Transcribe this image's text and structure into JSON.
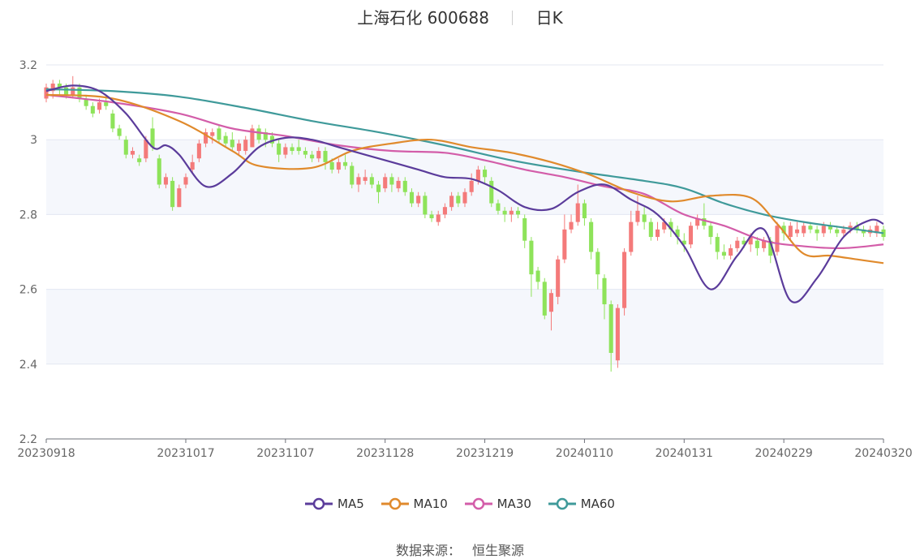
{
  "header": {
    "name": "上海石化",
    "code": "600688",
    "period": "日K"
  },
  "source": {
    "label": "数据来源：",
    "value": "恒生聚源"
  },
  "colors": {
    "up": "#f47a7a",
    "down": "#8ee35a",
    "grid": "#e3e7f2",
    "band": "#f5f7fc",
    "MA5": "#5b3c9b",
    "MA10": "#e08a2c",
    "MA30": "#d35da9",
    "MA60": "#3f9a9a"
  },
  "chart_data": {
    "type": "candlestick",
    "x_ticks": [
      "20230918",
      "20231017",
      "20231107",
      "20231128",
      "20231219",
      "20240110",
      "20240131",
      "20240229",
      "20240320"
    ],
    "x_tick_index": [
      0,
      21,
      36,
      51,
      66,
      81,
      96,
      111,
      126
    ],
    "ylim": [
      2.2,
      3.2
    ],
    "y_ticks": [
      "2.2",
      "2.4",
      "2.6",
      "2.8",
      "3",
      "3.2"
    ],
    "legend": [
      "MA5",
      "MA10",
      "MA30",
      "MA60"
    ],
    "candles": [
      [
        3.11,
        3.14,
        3.15,
        3.1
      ],
      [
        3.13,
        3.15,
        3.16,
        3.11
      ],
      [
        3.15,
        3.14,
        3.16,
        3.12
      ],
      [
        3.14,
        3.12,
        3.15,
        3.11
      ],
      [
        3.12,
        3.14,
        3.17,
        3.11
      ],
      [
        3.14,
        3.11,
        3.15,
        3.1
      ],
      [
        3.11,
        3.09,
        3.12,
        3.08
      ],
      [
        3.09,
        3.07,
        3.1,
        3.06
      ],
      [
        3.08,
        3.1,
        3.11,
        3.07
      ],
      [
        3.1,
        3.09,
        3.12,
        3.08
      ],
      [
        3.07,
        3.03,
        3.08,
        3.02
      ],
      [
        3.03,
        3.01,
        3.04,
        3.0
      ],
      [
        3.0,
        2.96,
        3.01,
        2.95
      ],
      [
        2.96,
        2.97,
        2.98,
        2.95
      ],
      [
        2.95,
        2.94,
        2.96,
        2.93
      ],
      [
        2.95,
        3.0,
        3.01,
        2.94
      ],
      [
        3.03,
        2.98,
        3.06,
        2.97
      ],
      [
        2.95,
        2.88,
        2.96,
        2.87
      ],
      [
        2.88,
        2.9,
        2.91,
        2.87
      ],
      [
        2.89,
        2.82,
        2.9,
        2.81
      ],
      [
        2.82,
        2.87,
        2.88,
        2.82
      ],
      [
        2.88,
        2.9,
        2.91,
        2.87
      ],
      [
        2.92,
        2.94,
        2.96,
        2.91
      ],
      [
        2.95,
        2.99,
        3.0,
        2.94
      ],
      [
        2.99,
        3.02,
        3.03,
        2.98
      ],
      [
        3.01,
        3.02,
        3.03,
        2.99
      ],
      [
        3.03,
        3.0,
        3.04,
        2.99
      ],
      [
        3.01,
        2.99,
        3.02,
        2.98
      ],
      [
        3.0,
        2.98,
        3.02,
        2.97
      ],
      [
        2.97,
        2.99,
        3.0,
        2.96
      ],
      [
        2.97,
        3.0,
        3.01,
        2.96
      ],
      [
        2.98,
        3.03,
        3.04,
        2.98
      ],
      [
        3.03,
        3.0,
        3.04,
        2.99
      ],
      [
        3.02,
        3.0,
        3.03,
        2.98
      ],
      [
        3.01,
        2.99,
        3.02,
        2.98
      ],
      [
        2.99,
        2.96,
        3.0,
        2.94
      ],
      [
        2.96,
        2.98,
        2.99,
        2.95
      ],
      [
        2.98,
        2.97,
        2.99,
        2.96
      ],
      [
        2.98,
        2.97,
        3.0,
        2.96
      ],
      [
        2.97,
        2.96,
        2.98,
        2.95
      ],
      [
        2.96,
        2.95,
        2.97,
        2.94
      ],
      [
        2.95,
        2.97,
        2.98,
        2.94
      ],
      [
        2.97,
        2.94,
        2.98,
        2.92
      ],
      [
        2.94,
        2.92,
        2.95,
        2.91
      ],
      [
        2.92,
        2.94,
        2.95,
        2.91
      ],
      [
        2.94,
        2.93,
        2.96,
        2.92
      ],
      [
        2.93,
        2.88,
        2.94,
        2.87
      ],
      [
        2.88,
        2.9,
        2.91,
        2.86
      ],
      [
        2.89,
        2.9,
        2.92,
        2.88
      ],
      [
        2.9,
        2.88,
        2.91,
        2.87
      ],
      [
        2.88,
        2.86,
        2.89,
        2.83
      ],
      [
        2.87,
        2.9,
        2.91,
        2.86
      ],
      [
        2.9,
        2.88,
        2.91,
        2.86
      ],
      [
        2.87,
        2.89,
        2.9,
        2.86
      ],
      [
        2.89,
        2.86,
        2.9,
        2.85
      ],
      [
        2.86,
        2.83,
        2.87,
        2.82
      ],
      [
        2.83,
        2.85,
        2.86,
        2.82
      ],
      [
        2.85,
        2.8,
        2.86,
        2.79
      ],
      [
        2.8,
        2.79,
        2.81,
        2.78
      ],
      [
        2.78,
        2.8,
        2.81,
        2.77
      ],
      [
        2.8,
        2.82,
        2.83,
        2.79
      ],
      [
        2.82,
        2.85,
        2.86,
        2.81
      ],
      [
        2.85,
        2.83,
        2.86,
        2.82
      ],
      [
        2.83,
        2.86,
        2.87,
        2.82
      ],
      [
        2.86,
        2.89,
        2.91,
        2.85
      ],
      [
        2.89,
        2.92,
        2.93,
        2.88
      ],
      [
        2.92,
        2.9,
        2.93,
        2.88
      ],
      [
        2.89,
        2.83,
        2.9,
        2.82
      ],
      [
        2.83,
        2.81,
        2.84,
        2.8
      ],
      [
        2.81,
        2.8,
        2.82,
        2.78
      ],
      [
        2.8,
        2.81,
        2.82,
        2.78
      ],
      [
        2.81,
        2.8,
        2.82,
        2.79
      ],
      [
        2.79,
        2.73,
        2.8,
        2.71
      ],
      [
        2.73,
        2.64,
        2.74,
        2.58
      ],
      [
        2.65,
        2.62,
        2.66,
        2.6
      ],
      [
        2.62,
        2.53,
        2.63,
        2.52
      ],
      [
        2.54,
        2.59,
        2.6,
        2.49
      ],
      [
        2.58,
        2.68,
        2.69,
        2.56
      ],
      [
        2.68,
        2.76,
        2.8,
        2.67
      ],
      [
        2.76,
        2.78,
        2.8,
        2.75
      ],
      [
        2.78,
        2.83,
        2.88,
        2.77
      ],
      [
        2.83,
        2.79,
        2.84,
        2.77
      ],
      [
        2.78,
        2.7,
        2.79,
        2.68
      ],
      [
        2.7,
        2.64,
        2.71,
        2.6
      ],
      [
        2.63,
        2.56,
        2.64,
        2.52
      ],
      [
        2.56,
        2.43,
        2.57,
        2.38
      ],
      [
        2.41,
        2.55,
        2.56,
        2.39
      ],
      [
        2.55,
        2.7,
        2.71,
        2.53
      ],
      [
        2.7,
        2.78,
        2.81,
        2.69
      ],
      [
        2.78,
        2.81,
        2.85,
        2.77
      ],
      [
        2.8,
        2.78,
        2.82,
        2.76
      ],
      [
        2.78,
        2.74,
        2.79,
        2.73
      ],
      [
        2.74,
        2.76,
        2.78,
        2.73
      ],
      [
        2.76,
        2.78,
        2.79,
        2.75
      ],
      [
        2.78,
        2.76,
        2.79,
        2.74
      ],
      [
        2.76,
        2.74,
        2.77,
        2.72
      ],
      [
        2.73,
        2.72,
        2.75,
        2.7
      ],
      [
        2.72,
        2.77,
        2.78,
        2.71
      ],
      [
        2.77,
        2.79,
        2.8,
        2.76
      ],
      [
        2.79,
        2.77,
        2.83,
        2.76
      ],
      [
        2.77,
        2.74,
        2.78,
        2.72
      ],
      [
        2.74,
        2.7,
        2.75,
        2.68
      ],
      [
        2.7,
        2.69,
        2.72,
        2.68
      ],
      [
        2.69,
        2.71,
        2.72,
        2.68
      ],
      [
        2.71,
        2.73,
        2.74,
        2.7
      ],
      [
        2.73,
        2.72,
        2.74,
        2.71
      ],
      [
        2.72,
        2.74,
        2.75,
        2.7
      ],
      [
        2.73,
        2.71,
        2.74,
        2.69
      ],
      [
        2.71,
        2.73,
        2.74,
        2.7
      ],
      [
        2.73,
        2.69,
        2.74,
        2.67
      ],
      [
        2.7,
        2.77,
        2.78,
        2.69
      ],
      [
        2.77,
        2.75,
        2.78,
        2.73
      ],
      [
        2.74,
        2.77,
        2.78,
        2.73
      ],
      [
        2.75,
        2.76,
        2.78,
        2.74
      ],
      [
        2.75,
        2.77,
        2.78,
        2.74
      ],
      [
        2.77,
        2.76,
        2.78,
        2.75
      ],
      [
        2.76,
        2.75,
        2.77,
        2.73
      ],
      [
        2.75,
        2.77,
        2.78,
        2.74
      ],
      [
        2.77,
        2.76,
        2.78,
        2.75
      ],
      [
        2.76,
        2.75,
        2.77,
        2.74
      ],
      [
        2.75,
        2.76,
        2.77,
        2.74
      ],
      [
        2.76,
        2.77,
        2.78,
        2.75
      ],
      [
        2.77,
        2.76,
        2.78,
        2.75
      ],
      [
        2.76,
        2.75,
        2.77,
        2.74
      ],
      [
        2.75,
        2.76,
        2.77,
        2.74
      ],
      [
        2.75,
        2.77,
        2.78,
        2.74
      ],
      [
        2.76,
        2.74,
        2.77,
        2.73
      ]
    ],
    "ma": {
      "MA5": [
        [
          0,
          3.13
        ],
        [
          4,
          3.145
        ],
        [
          8,
          3.13
        ],
        [
          12,
          3.07
        ],
        [
          16,
          2.98
        ],
        [
          18,
          2.985
        ],
        [
          20,
          2.96
        ],
        [
          24,
          2.875
        ],
        [
          28,
          2.91
        ],
        [
          32,
          2.98
        ],
        [
          36,
          3.005
        ],
        [
          40,
          3.0
        ],
        [
          44,
          2.98
        ],
        [
          48,
          2.96
        ],
        [
          52,
          2.94
        ],
        [
          56,
          2.92
        ],
        [
          60,
          2.9
        ],
        [
          64,
          2.895
        ],
        [
          68,
          2.865
        ],
        [
          72,
          2.82
        ],
        [
          76,
          2.815
        ],
        [
          80,
          2.86
        ],
        [
          84,
          2.88
        ],
        [
          88,
          2.84
        ],
        [
          92,
          2.8
        ],
        [
          96,
          2.715
        ],
        [
          100,
          2.6
        ],
        [
          104,
          2.69
        ],
        [
          108,
          2.76
        ],
        [
          112,
          2.57
        ],
        [
          116,
          2.63
        ],
        [
          120,
          2.74
        ],
        [
          124,
          2.785
        ],
        [
          126,
          2.775
        ]
      ],
      "MA10": [
        [
          0,
          3.12
        ],
        [
          10,
          3.11
        ],
        [
          20,
          3.05
        ],
        [
          28,
          2.97
        ],
        [
          32,
          2.93
        ],
        [
          40,
          2.925
        ],
        [
          46,
          2.97
        ],
        [
          52,
          2.99
        ],
        [
          58,
          3.0
        ],
        [
          64,
          2.98
        ],
        [
          70,
          2.965
        ],
        [
          76,
          2.94
        ],
        [
          82,
          2.905
        ],
        [
          88,
          2.86
        ],
        [
          94,
          2.835
        ],
        [
          100,
          2.85
        ],
        [
          106,
          2.845
        ],
        [
          110,
          2.775
        ],
        [
          114,
          2.695
        ],
        [
          118,
          2.69
        ],
        [
          122,
          2.68
        ],
        [
          126,
          2.67
        ]
      ],
      "MA30": [
        [
          0,
          3.12
        ],
        [
          10,
          3.1
        ],
        [
          20,
          3.07
        ],
        [
          28,
          3.03
        ],
        [
          36,
          3.01
        ],
        [
          44,
          2.985
        ],
        [
          52,
          2.97
        ],
        [
          60,
          2.965
        ],
        [
          66,
          2.945
        ],
        [
          72,
          2.92
        ],
        [
          78,
          2.9
        ],
        [
          84,
          2.875
        ],
        [
          90,
          2.855
        ],
        [
          96,
          2.8
        ],
        [
          102,
          2.77
        ],
        [
          108,
          2.73
        ],
        [
          114,
          2.715
        ],
        [
          120,
          2.71
        ],
        [
          126,
          2.72
        ]
      ],
      "MA60": [
        [
          0,
          3.135
        ],
        [
          10,
          3.13
        ],
        [
          20,
          3.115
        ],
        [
          30,
          3.085
        ],
        [
          40,
          3.05
        ],
        [
          50,
          3.02
        ],
        [
          60,
          2.985
        ],
        [
          70,
          2.945
        ],
        [
          80,
          2.915
        ],
        [
          90,
          2.89
        ],
        [
          96,
          2.87
        ],
        [
          102,
          2.83
        ],
        [
          108,
          2.8
        ],
        [
          114,
          2.78
        ],
        [
          120,
          2.765
        ],
        [
          126,
          2.75
        ]
      ]
    }
  }
}
